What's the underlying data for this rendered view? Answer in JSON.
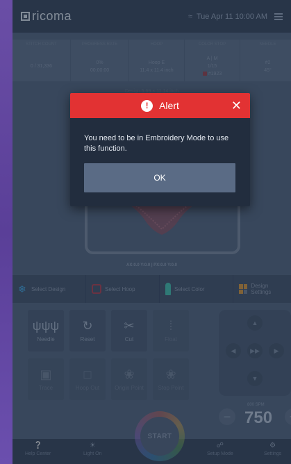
{
  "topbar": {
    "brand": "ricoma",
    "datetime": "Tue Apr 11  10:00 AM"
  },
  "stats": {
    "headers": [
      "STITCH COUNT",
      "PROGRESS RATE",
      "HOOP",
      "COLOR STOP",
      "NEEDLE"
    ],
    "stitch_count": "0 / 31,336",
    "progress_rate": "0%",
    "progress_time": "00:00:00",
    "hoop_name": "Hoop E",
    "hoop_size": "11.4 x 11.4 inch",
    "color_stop_label": "A | M",
    "color_stop_count": "1/15",
    "color_code": "#1923",
    "needle": "#2",
    "needle_angle": "45°"
  },
  "design_size": "Design 5.69 × 11.14 inch",
  "coords": "AX:0.0 Y:0.0  |  PX:0.0 Y:0.0",
  "toolbar": {
    "select_design": "Select Design",
    "select_hoop": "Select Hoop",
    "select_color": "Select Color",
    "design_settings": "Design Settings"
  },
  "controls": {
    "needle": "Needle",
    "reset": "Reset",
    "cut": "Cut",
    "float": "Float",
    "trace": "Trace",
    "hoop_out": "Hoop Out",
    "origin_point": "Origin Point",
    "stop_point": "Stop Point"
  },
  "speed": {
    "label": "800 SPM",
    "value": "750"
  },
  "start": "START",
  "bottom": {
    "help_center": "Help Center",
    "light_on": "Light On",
    "setup_mode": "Setup Mode",
    "settings": "Settings"
  },
  "alert": {
    "title": "Alert",
    "message": "You need to be in Embroidery Mode to use this function.",
    "ok": "OK"
  },
  "colors": {
    "alert_red": "#e23233",
    "alert_body": "#222d3e",
    "ok_button": "#5a6b85"
  }
}
